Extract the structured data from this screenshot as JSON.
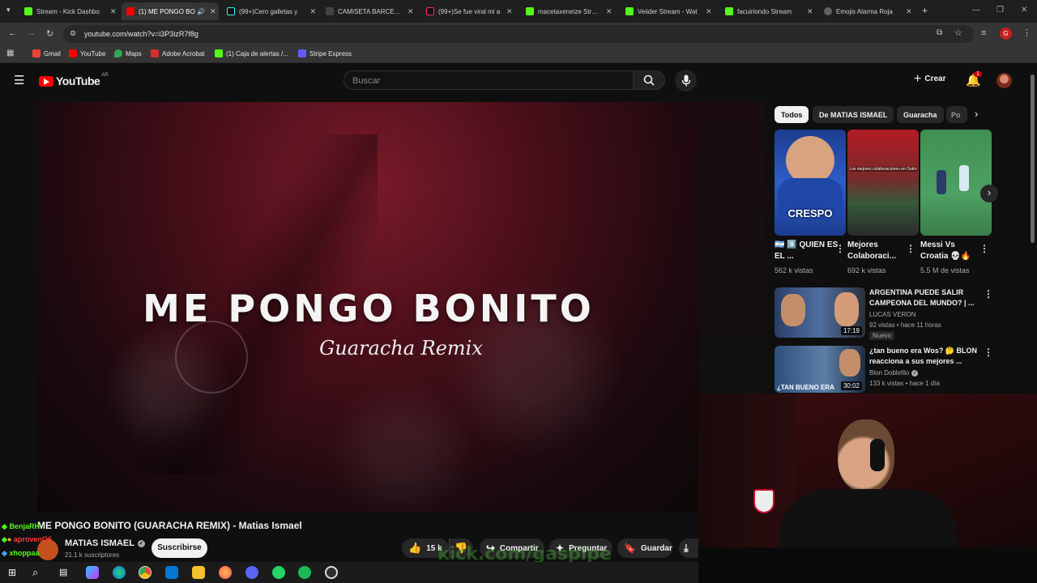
{
  "browser": {
    "tabs": [
      {
        "title": "Stream - Kick Dashbo",
        "color": "#53fc18"
      },
      {
        "title": "(1) ME PONGO BO",
        "color": "#ff0000",
        "active": true
      },
      {
        "title": "(99+)Cero galletas y",
        "color": "#111111"
      },
      {
        "title": "CAMISETA BARCELON",
        "color": "#222222"
      },
      {
        "title": "(99+)Se fue viral mi a",
        "color": "#111111"
      },
      {
        "title": "macetaxeneize Stream",
        "color": "#53fc18"
      },
      {
        "title": "Veiider Stream - Wat",
        "color": "#53fc18"
      },
      {
        "title": "facuiriondo Stream",
        "color": "#53fc18"
      },
      {
        "title": "Emojis Alarma Roja",
        "color": "#5f6368"
      }
    ],
    "url": "youtube.com/watch?v=i3P3izR7f8g",
    "profile_initial": "G",
    "bookmarks": [
      {
        "label": "Gmail",
        "color": "#ea4335"
      },
      {
        "label": "YouTube",
        "color": "#ff0000"
      },
      {
        "label": "Maps",
        "color": "#34a853"
      },
      {
        "label": "Adobe Acrobat",
        "color": "#d32f2f"
      },
      {
        "label": "(1) Caja de alertas /...",
        "color": "#53fc18"
      },
      {
        "label": "Stripe Express",
        "color": "#635bff"
      }
    ]
  },
  "youtube": {
    "logo_text": "YouTube",
    "region": "AR",
    "search_placeholder": "Buscar",
    "create_label": "Crear",
    "notification_count": "1",
    "chips": [
      "Todos",
      "De MATIAS ISMAEL",
      "Guaracha",
      "Po"
    ],
    "shorts": [
      {
        "title": "🇦🇷 9️⃣ QUIEN ES EL ...",
        "views": "562 k vistas",
        "overlay": "CRESPO"
      },
      {
        "title": "Mejores Colaboraci...",
        "views": "692 k vistas",
        "overlay": "Los mejores colaboraciones en Outro"
      },
      {
        "title": "Messi Vs Croatia 💀🔥",
        "views": "5.5 M de vistas",
        "overlay": ""
      }
    ],
    "recommended": [
      {
        "title": "ARGENTINA PUEDE SALIR CAMPEONA DEL MUNDO? | ...",
        "channel": "LUCAS VERON",
        "meta": "92 vistas • hace 11 horas",
        "badge": "Nuevo",
        "duration": "17:19",
        "thumb_text": ""
      },
      {
        "title": "¿tan bueno era Wos? 🤔 BLON reacciona a sus mejores ...",
        "channel": "Blon Doblefilo",
        "meta": "133 k vistas • hace 1 día",
        "badge": "",
        "duration": "30:02",
        "thumb_text": "¿TAN BUENO ERA"
      }
    ],
    "video": {
      "art_title": "ME PONGO BONITO",
      "art_subtitle": "Guaracha Remix",
      "title": "ME PONGO BONITO (GUARACHA REMIX) - Matias Ismael",
      "channel": "MATIAS ISMAEL",
      "subscribers": "21.1 k suscriptores",
      "subscribe_label": "Suscribirse",
      "likes": "15 k",
      "share_label": "Compartir",
      "ask_label": "Preguntar",
      "save_label": "Guardar"
    }
  },
  "stream": {
    "chat": [
      {
        "user": "BenjaRH",
        "color": "#53fc18"
      },
      {
        "user": "aprovenO6",
        "color": "#ff3b3b"
      },
      {
        "user": "xhoppaa",
        "color": "#53fc18"
      }
    ],
    "watermark": "kick.com/gaspipe"
  }
}
